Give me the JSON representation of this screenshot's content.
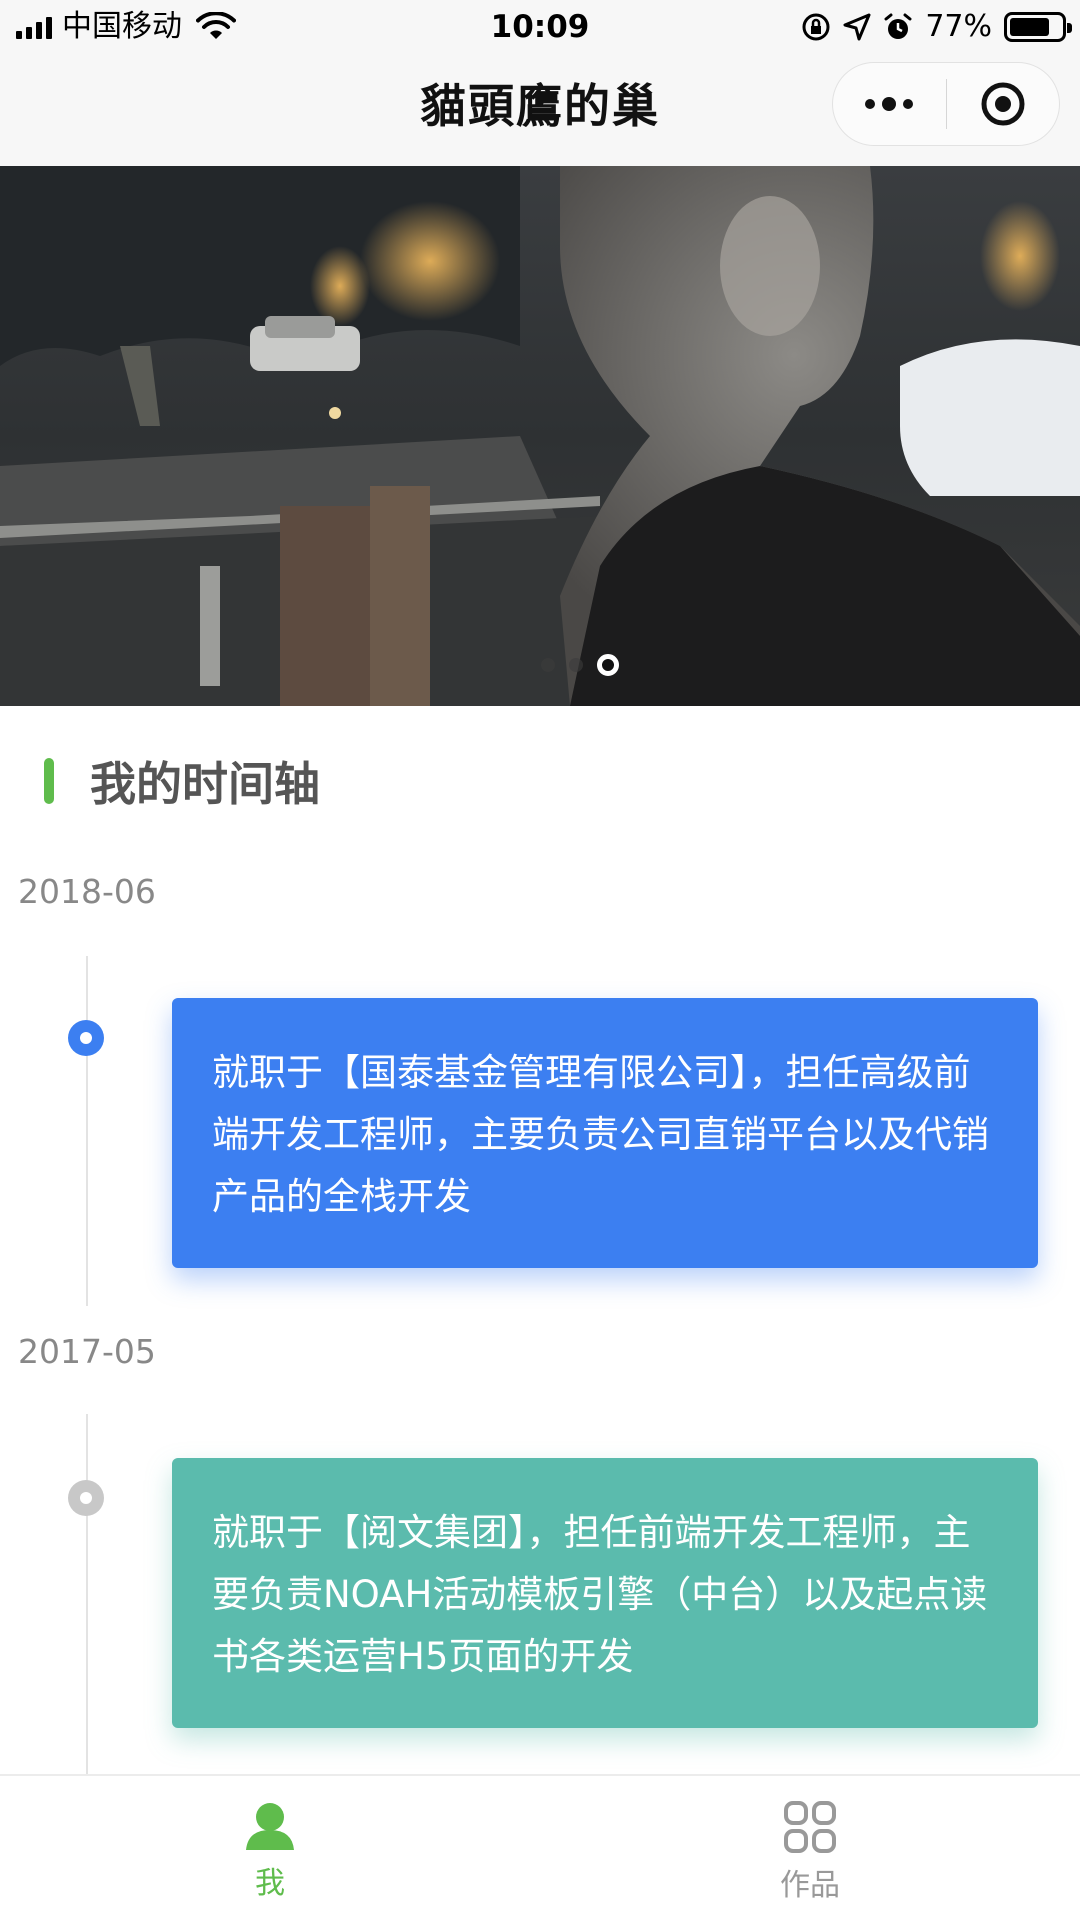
{
  "status_bar": {
    "carrier": "中国移动",
    "time": "10:09",
    "battery_percent": "77%",
    "battery_level": 0.77,
    "icons": [
      "signal-icon",
      "wifi-icon",
      "orientation-lock-icon",
      "location-icon",
      "alarm-icon",
      "battery-icon"
    ]
  },
  "nav_bar": {
    "title": "貓頭鷹的巢",
    "capsule": [
      "more-icon",
      "close-target-icon"
    ]
  },
  "banner": {
    "slide_count": 3,
    "active_slide": 3
  },
  "section": {
    "title": "我的时间轴",
    "accent_color": "#5fbc4c"
  },
  "timeline": [
    {
      "date": "2018-06",
      "text": "就职于【国泰基金管理有限公司】，担任高级前端开发工程师，主要负责公司直销平台以及代销产品的全栈开发",
      "color": "#3c7ff1",
      "node_state": "active"
    },
    {
      "date": "2017-05",
      "text": "就职于【阅文集团】，担任前端开发工程师，主要负责NOAH活动模板引擎（中台）以及起点读书各类运营H5页面的开发",
      "color": "#5bbbad",
      "node_state": "inactive"
    }
  ],
  "tab_bar": {
    "tabs": [
      {
        "label": "我",
        "icon": "person-icon",
        "active": true
      },
      {
        "label": "作品",
        "icon": "works-grid-icon",
        "active": false
      }
    ],
    "active_color": "#5fbc4c",
    "inactive_color": "#999999"
  }
}
